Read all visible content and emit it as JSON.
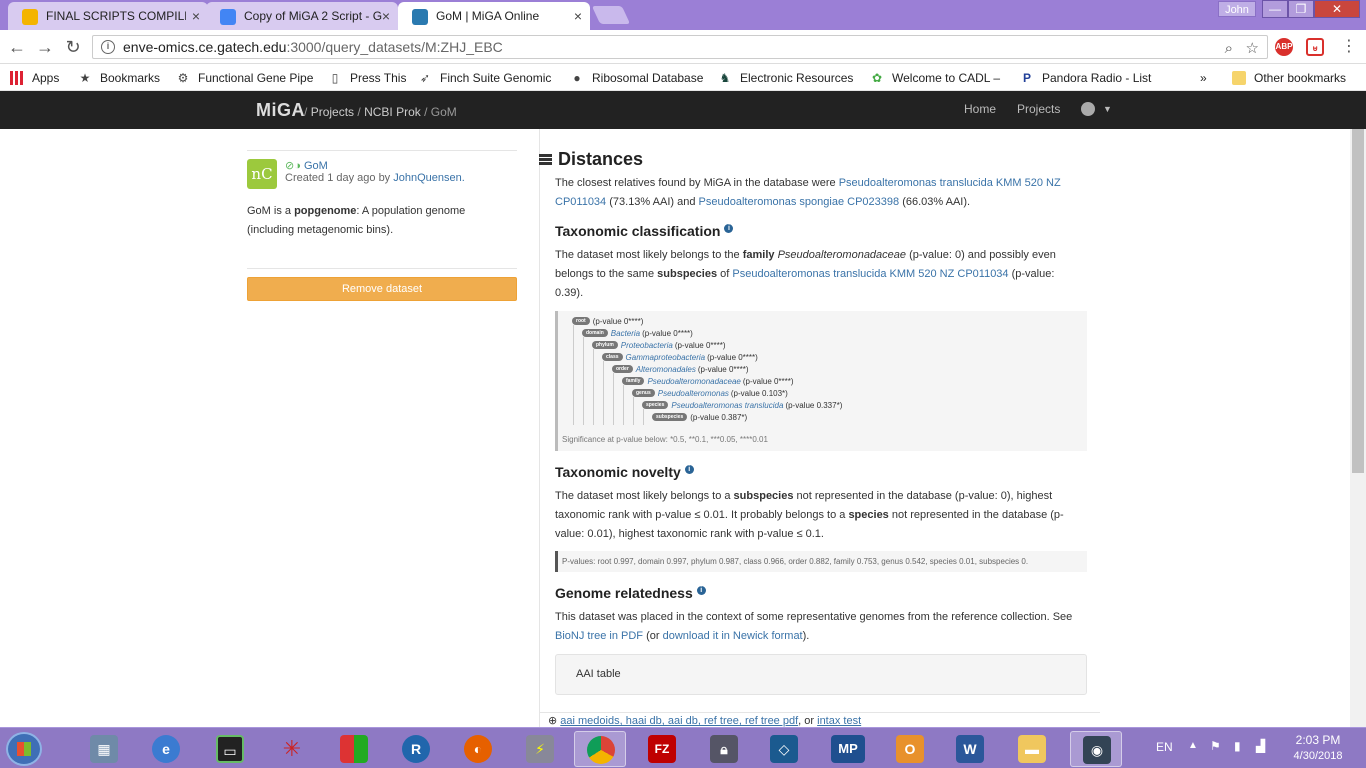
{
  "browser": {
    "tabs": [
      {
        "title": "FINAL SCRIPTS COMPILE",
        "close": "×"
      },
      {
        "title": "Copy of MiGA 2 Script - G",
        "close": "×"
      },
      {
        "title": "GoM | MiGA Online",
        "close": "×"
      }
    ],
    "window_user": "John",
    "window_buttons": {
      "minimize": "—",
      "maximize": "❐",
      "close": "✕"
    },
    "url_host": "enve-omics.ce.gatech.edu",
    "url_path": ":3000/query_datasets/M:ZHJ_EBC",
    "extensions": {
      "abp": "ABP"
    }
  },
  "bookmarks": {
    "items": [
      {
        "label": "Apps"
      },
      {
        "label": "Bookmarks"
      },
      {
        "label": "Functional Gene Pipe"
      },
      {
        "label": "Press This"
      },
      {
        "label": "Finch Suite Genomic"
      },
      {
        "label": "Ribosomal Database"
      },
      {
        "label": "Electronic Resources"
      },
      {
        "label": "Welcome to CADL –"
      },
      {
        "label": "Pandora Radio - List"
      }
    ],
    "overflow": "»",
    "other": "Other bookmarks"
  },
  "navbar": {
    "brand": "MiGA",
    "crumb_sep1": "/",
    "crumb_projects": "Projects",
    "crumb_sep2": "/",
    "crumb_project": "NCBI Prok",
    "crumb_sep3": "/",
    "crumb_dataset": "GoM",
    "home": "Home",
    "projects": "Projects"
  },
  "sidebar": {
    "logo_text": "nC",
    "status_icons": "⊘◑",
    "name": "GoM",
    "created_prefix": "Created 1 day ago by",
    "created_user": "JohnQuensen.",
    "desc_prefix": "GoM is a",
    "desc_type": "popgenome",
    "desc_suffix": ": A population genome (including metagenomic bins).",
    "remove_button": "Remove dataset"
  },
  "main": {
    "title": "Distances",
    "closest_prefix": "The closest relatives found by MiGA in the database were",
    "closest_1": "Pseudoalteromonas translucida KMM 520 NZ CP011034",
    "closest_1_aai": "(73.13% AAI) and",
    "closest_2": "Pseudoalteromonas spongiae CP023398",
    "closest_2_aai": "(66.03% AAI).",
    "tax_title": "Taxonomic classification",
    "tax_p1": "The dataset most likely belongs to the",
    "tax_family_word": "family",
    "tax_family": "Pseudoalteromonadaceae",
    "tax_p2": "(p-value: 0) and possibly even belongs to the same",
    "tax_sub_word": "subspecies",
    "tax_p3": "of",
    "tax_sub_link": "Pseudoalteromonas translucida KMM 520 NZ CP011034",
    "tax_p4": "(p-value: 0.39).",
    "tree": [
      {
        "rank": "root",
        "taxon": "",
        "pv": "(p-value 0****)"
      },
      {
        "rank": "domain",
        "taxon": "Bacteria",
        "pv": "(p-value 0****)"
      },
      {
        "rank": "phylum",
        "taxon": "Proteobacteria",
        "pv": "(p-value 0****)"
      },
      {
        "rank": "class",
        "taxon": "Gammaproteobacteria",
        "pv": "(p-value 0****)"
      },
      {
        "rank": "order",
        "taxon": "Alteromonadales",
        "pv": "(p-value 0****)"
      },
      {
        "rank": "family",
        "taxon": "Pseudoalteromonadaceae",
        "pv": "(p-value 0****)"
      },
      {
        "rank": "genus",
        "taxon": "Pseudoalteromonas",
        "pv": "(p-value 0.103*)"
      },
      {
        "rank": "species",
        "taxon": "Pseudoalteromonas translucida",
        "pv": "(p-value 0.337*)"
      },
      {
        "rank": "subspecies",
        "taxon": "",
        "pv": "(p-value 0.387*)"
      }
    ],
    "significance": "Significance at p-value below: *0.5, **0.1, ***0.05, ****0.01",
    "novelty_title": "Taxonomic novelty",
    "nov_p1": "The dataset most likely belongs to a",
    "nov_sub_word": "subspecies",
    "nov_p2": "not represented in the database (p-value: 0), highest taxonomic rank with p-value ≤ 0.01. It probably belongs to a",
    "nov_species_word": "species",
    "nov_p3": "not represented in the database (p-value: 0.01), highest taxonomic rank with p-value ≤ 0.1.",
    "pvalues": "P-values: root 0.997, domain 0.997, phylum 0.987, class 0.966, order 0.882, family 0.753, genus 0.542, species 0.01, subspecies 0.",
    "related_title": "Genome relatedness",
    "rel_p1": "This dataset was placed in the context of some representative genomes from the reference collection. See",
    "rel_link1": "BioNJ tree in PDF",
    "rel_p2": "(or",
    "rel_link2": "download it in Newick format",
    "rel_p3": ").",
    "aai_table": "AAI table",
    "files_prefix": "⊕",
    "files_links": "aai medoids, haai db, aai db, ref tree, ref tree pdf",
    "files_or": ", or",
    "files_last": "intax test"
  },
  "taskbar": {
    "lang": "EN",
    "time": "2:03 PM",
    "date": "4/30/2018",
    "apps": [
      "calculator",
      "ie",
      "terminal",
      "network",
      "office",
      "r",
      "firefox",
      "putty",
      "chrome",
      "filezilla",
      "security",
      "virtualbox",
      "mp",
      "outlook",
      "word",
      "explorer",
      "camera"
    ],
    "mp_label": "MP",
    "r_label": "R",
    "fz_label": "FZ",
    "word_label": "W",
    "outlook_label": "O"
  }
}
